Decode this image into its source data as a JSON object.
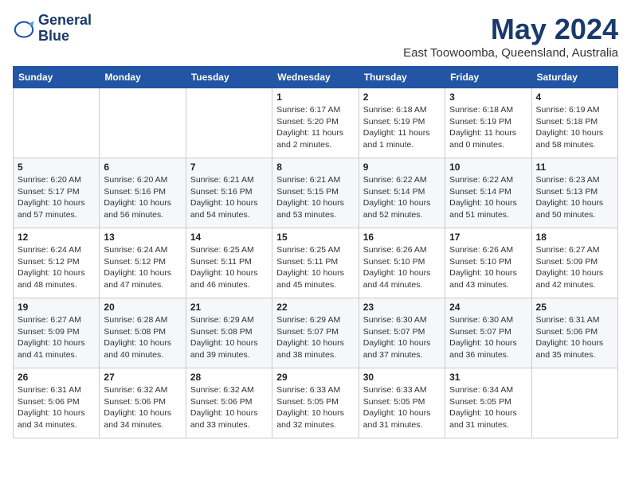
{
  "logo": {
    "line1": "General",
    "line2": "Blue"
  },
  "title": "May 2024",
  "subtitle": "East Toowoomba, Queensland, Australia",
  "days_of_week": [
    "Sunday",
    "Monday",
    "Tuesday",
    "Wednesday",
    "Thursday",
    "Friday",
    "Saturday"
  ],
  "weeks": [
    [
      {
        "day": "",
        "sunrise": "",
        "sunset": "",
        "daylight": ""
      },
      {
        "day": "",
        "sunrise": "",
        "sunset": "",
        "daylight": ""
      },
      {
        "day": "",
        "sunrise": "",
        "sunset": "",
        "daylight": ""
      },
      {
        "day": "1",
        "sunrise": "Sunrise: 6:17 AM",
        "sunset": "Sunset: 5:20 PM",
        "daylight": "Daylight: 11 hours and 2 minutes."
      },
      {
        "day": "2",
        "sunrise": "Sunrise: 6:18 AM",
        "sunset": "Sunset: 5:19 PM",
        "daylight": "Daylight: 11 hours and 1 minute."
      },
      {
        "day": "3",
        "sunrise": "Sunrise: 6:18 AM",
        "sunset": "Sunset: 5:19 PM",
        "daylight": "Daylight: 11 hours and 0 minutes."
      },
      {
        "day": "4",
        "sunrise": "Sunrise: 6:19 AM",
        "sunset": "Sunset: 5:18 PM",
        "daylight": "Daylight: 10 hours and 58 minutes."
      }
    ],
    [
      {
        "day": "5",
        "sunrise": "Sunrise: 6:20 AM",
        "sunset": "Sunset: 5:17 PM",
        "daylight": "Daylight: 10 hours and 57 minutes."
      },
      {
        "day": "6",
        "sunrise": "Sunrise: 6:20 AM",
        "sunset": "Sunset: 5:16 PM",
        "daylight": "Daylight: 10 hours and 56 minutes."
      },
      {
        "day": "7",
        "sunrise": "Sunrise: 6:21 AM",
        "sunset": "Sunset: 5:16 PM",
        "daylight": "Daylight: 10 hours and 54 minutes."
      },
      {
        "day": "8",
        "sunrise": "Sunrise: 6:21 AM",
        "sunset": "Sunset: 5:15 PM",
        "daylight": "Daylight: 10 hours and 53 minutes."
      },
      {
        "day": "9",
        "sunrise": "Sunrise: 6:22 AM",
        "sunset": "Sunset: 5:14 PM",
        "daylight": "Daylight: 10 hours and 52 minutes."
      },
      {
        "day": "10",
        "sunrise": "Sunrise: 6:22 AM",
        "sunset": "Sunset: 5:14 PM",
        "daylight": "Daylight: 10 hours and 51 minutes."
      },
      {
        "day": "11",
        "sunrise": "Sunrise: 6:23 AM",
        "sunset": "Sunset: 5:13 PM",
        "daylight": "Daylight: 10 hours and 50 minutes."
      }
    ],
    [
      {
        "day": "12",
        "sunrise": "Sunrise: 6:24 AM",
        "sunset": "Sunset: 5:12 PM",
        "daylight": "Daylight: 10 hours and 48 minutes."
      },
      {
        "day": "13",
        "sunrise": "Sunrise: 6:24 AM",
        "sunset": "Sunset: 5:12 PM",
        "daylight": "Daylight: 10 hours and 47 minutes."
      },
      {
        "day": "14",
        "sunrise": "Sunrise: 6:25 AM",
        "sunset": "Sunset: 5:11 PM",
        "daylight": "Daylight: 10 hours and 46 minutes."
      },
      {
        "day": "15",
        "sunrise": "Sunrise: 6:25 AM",
        "sunset": "Sunset: 5:11 PM",
        "daylight": "Daylight: 10 hours and 45 minutes."
      },
      {
        "day": "16",
        "sunrise": "Sunrise: 6:26 AM",
        "sunset": "Sunset: 5:10 PM",
        "daylight": "Daylight: 10 hours and 44 minutes."
      },
      {
        "day": "17",
        "sunrise": "Sunrise: 6:26 AM",
        "sunset": "Sunset: 5:10 PM",
        "daylight": "Daylight: 10 hours and 43 minutes."
      },
      {
        "day": "18",
        "sunrise": "Sunrise: 6:27 AM",
        "sunset": "Sunset: 5:09 PM",
        "daylight": "Daylight: 10 hours and 42 minutes."
      }
    ],
    [
      {
        "day": "19",
        "sunrise": "Sunrise: 6:27 AM",
        "sunset": "Sunset: 5:09 PM",
        "daylight": "Daylight: 10 hours and 41 minutes."
      },
      {
        "day": "20",
        "sunrise": "Sunrise: 6:28 AM",
        "sunset": "Sunset: 5:08 PM",
        "daylight": "Daylight: 10 hours and 40 minutes."
      },
      {
        "day": "21",
        "sunrise": "Sunrise: 6:29 AM",
        "sunset": "Sunset: 5:08 PM",
        "daylight": "Daylight: 10 hours and 39 minutes."
      },
      {
        "day": "22",
        "sunrise": "Sunrise: 6:29 AM",
        "sunset": "Sunset: 5:07 PM",
        "daylight": "Daylight: 10 hours and 38 minutes."
      },
      {
        "day": "23",
        "sunrise": "Sunrise: 6:30 AM",
        "sunset": "Sunset: 5:07 PM",
        "daylight": "Daylight: 10 hours and 37 minutes."
      },
      {
        "day": "24",
        "sunrise": "Sunrise: 6:30 AM",
        "sunset": "Sunset: 5:07 PM",
        "daylight": "Daylight: 10 hours and 36 minutes."
      },
      {
        "day": "25",
        "sunrise": "Sunrise: 6:31 AM",
        "sunset": "Sunset: 5:06 PM",
        "daylight": "Daylight: 10 hours and 35 minutes."
      }
    ],
    [
      {
        "day": "26",
        "sunrise": "Sunrise: 6:31 AM",
        "sunset": "Sunset: 5:06 PM",
        "daylight": "Daylight: 10 hours and 34 minutes."
      },
      {
        "day": "27",
        "sunrise": "Sunrise: 6:32 AM",
        "sunset": "Sunset: 5:06 PM",
        "daylight": "Daylight: 10 hours and 34 minutes."
      },
      {
        "day": "28",
        "sunrise": "Sunrise: 6:32 AM",
        "sunset": "Sunset: 5:06 PM",
        "daylight": "Daylight: 10 hours and 33 minutes."
      },
      {
        "day": "29",
        "sunrise": "Sunrise: 6:33 AM",
        "sunset": "Sunset: 5:05 PM",
        "daylight": "Daylight: 10 hours and 32 minutes."
      },
      {
        "day": "30",
        "sunrise": "Sunrise: 6:33 AM",
        "sunset": "Sunset: 5:05 PM",
        "daylight": "Daylight: 10 hours and 31 minutes."
      },
      {
        "day": "31",
        "sunrise": "Sunrise: 6:34 AM",
        "sunset": "Sunset: 5:05 PM",
        "daylight": "Daylight: 10 hours and 31 minutes."
      },
      {
        "day": "",
        "sunrise": "",
        "sunset": "",
        "daylight": ""
      }
    ]
  ]
}
